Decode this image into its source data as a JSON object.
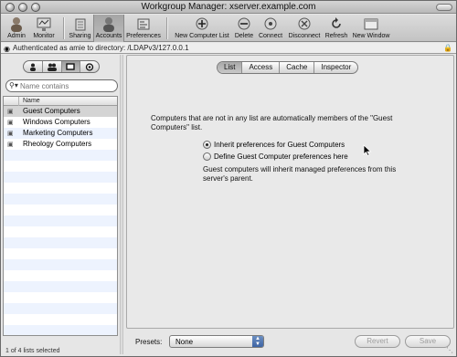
{
  "window": {
    "title": "Workgroup Manager: xserver.example.com"
  },
  "toolbar": {
    "admin": "Admin",
    "monitor": "Monitor",
    "sharing": "Sharing",
    "accounts": "Accounts",
    "preferences": "Preferences",
    "new_computer_list": "New Computer List",
    "delete": "Delete",
    "connect": "Connect",
    "disconnect": "Disconnect",
    "refresh": "Refresh",
    "new_window": "New Window"
  },
  "auth": {
    "text": "Authenticated as amie to directory: /LDAPv3/127.0.0.1"
  },
  "search": {
    "placeholder": "Name contains"
  },
  "list": {
    "header": "Name",
    "items": [
      {
        "label": "Guest Computers"
      },
      {
        "label": "Windows Computers"
      },
      {
        "label": "Marketing Computers"
      },
      {
        "label": "Rheology Computers"
      }
    ],
    "status": "1 of 4 lists selected"
  },
  "tabs": [
    "List",
    "Access",
    "Cache",
    "Inspector"
  ],
  "content": {
    "info": "Computers that are not in any list are automatically members of the \"Guest Computers\" list.",
    "option_inherit": "Inherit preferences for Guest Computers",
    "option_define": "Define Guest Computer preferences here",
    "note": "Guest computers will inherit managed preferences from this server's parent."
  },
  "footer": {
    "presets_label": "Presets:",
    "presets_value": "None",
    "revert": "Revert",
    "save": "Save"
  }
}
